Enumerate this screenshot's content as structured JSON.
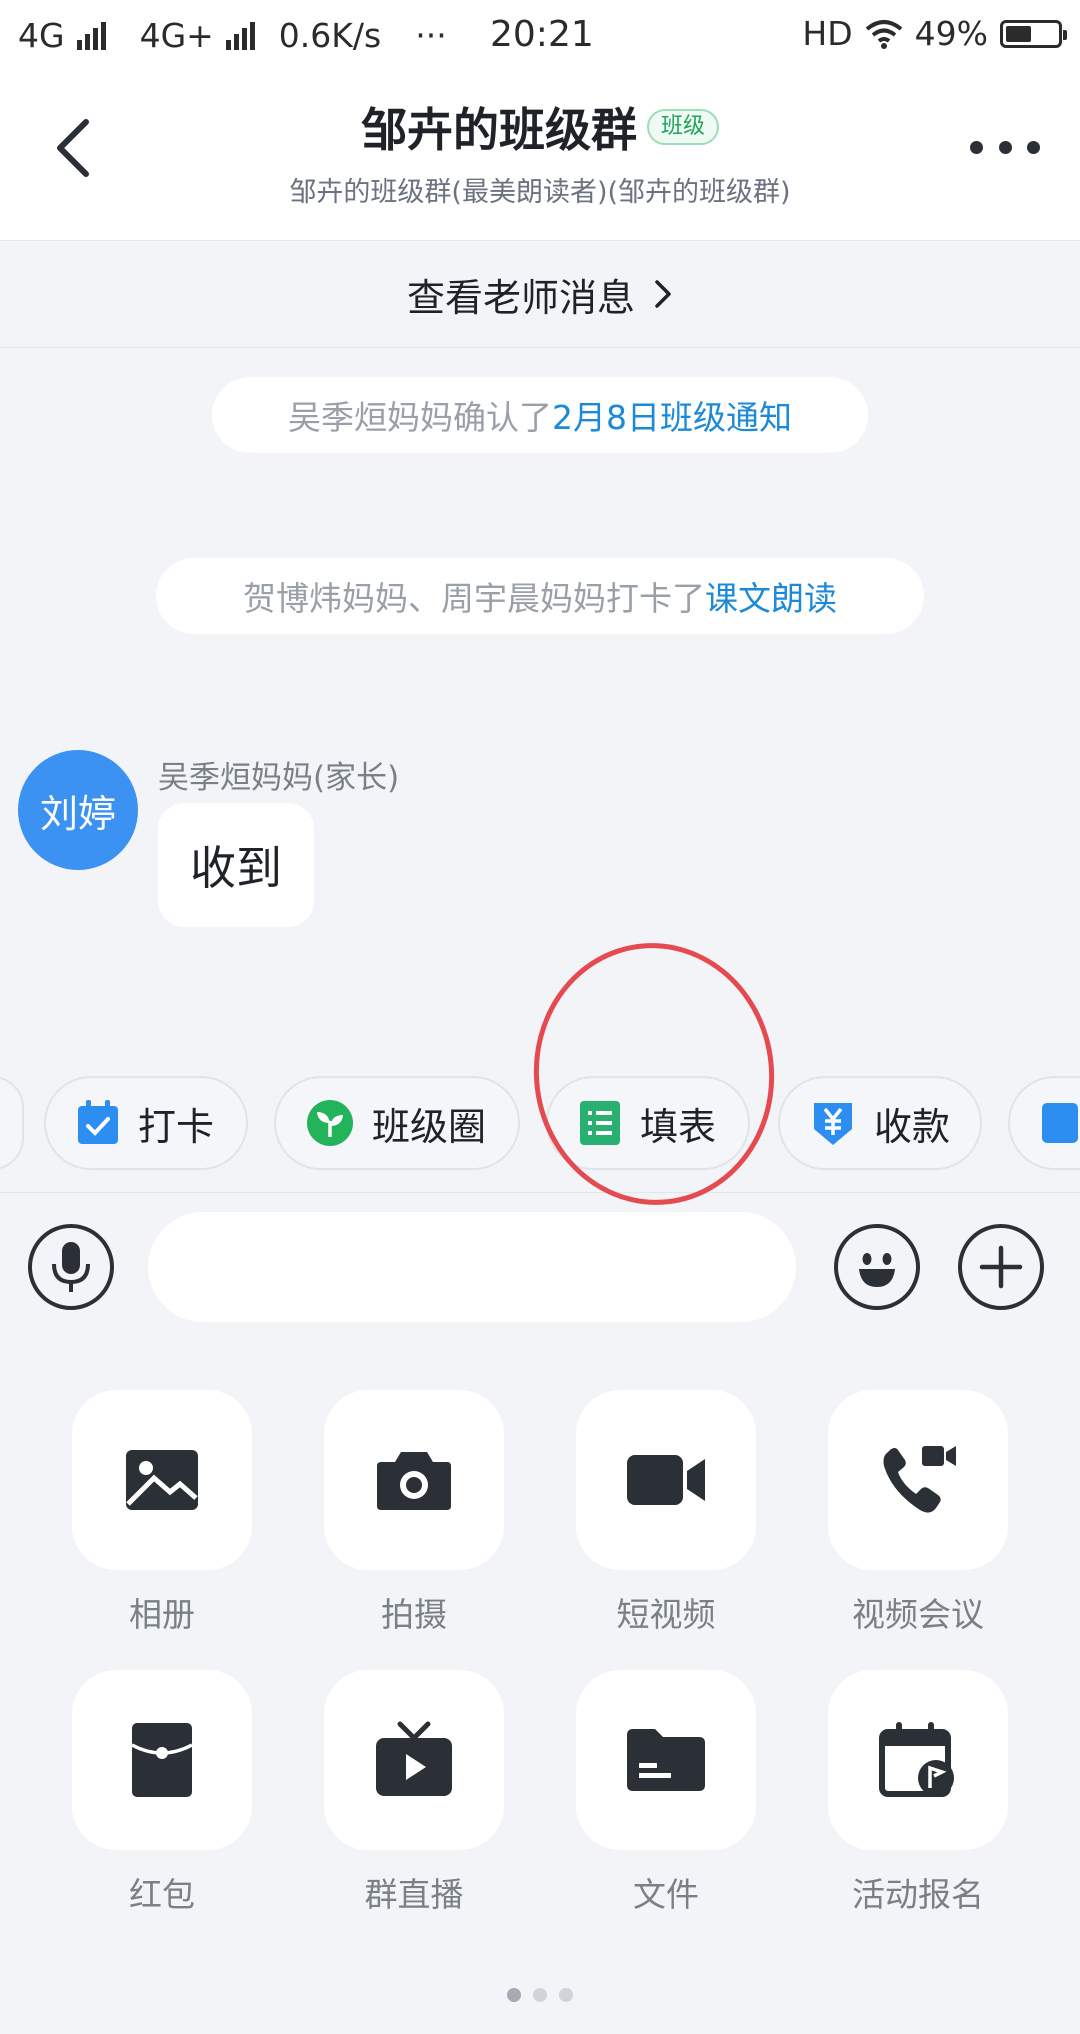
{
  "status_bar": {
    "network1": "4G",
    "network2": "4G+",
    "speed": "0.6K/s",
    "dots": "···",
    "time": "20:21",
    "hd": "HD",
    "battery_percent": "49%",
    "battery_level": 0.49
  },
  "header": {
    "title": "邹卉的班级群",
    "badge": "班级",
    "subtitle": "邹卉的班级群(最美朗读者)(邹卉的班级群)"
  },
  "teacher_bar": {
    "label": "查看老师消息",
    "chevron": "›"
  },
  "messages": {
    "system1": {
      "text": "吴季烜妈妈确认了",
      "link": "2月8日班级通知"
    },
    "system2": {
      "text": "贺博炜妈妈、周宇晨妈妈打卡了",
      "link": "课文朗读"
    },
    "chat": {
      "avatar_text": "刘婷",
      "sender": "吴季烜妈妈(家长)",
      "content": "收到"
    }
  },
  "quick_bar": {
    "items": [
      {
        "label": "打卡",
        "icon": "checkin-calendar-icon",
        "color": "#2b8ef0"
      },
      {
        "label": "班级圈",
        "icon": "sprout-icon",
        "color": "#22b35b"
      },
      {
        "label": "填表",
        "icon": "form-icon",
        "color": "#27b070"
      },
      {
        "label": "收款",
        "icon": "payment-yen-icon",
        "color": "#2b8ef0"
      }
    ]
  },
  "input": {
    "placeholder": "",
    "value": ""
  },
  "grid": {
    "items": [
      {
        "label": "相册",
        "icon": "image-icon"
      },
      {
        "label": "拍摄",
        "icon": "camera-icon"
      },
      {
        "label": "短视频",
        "icon": "video-icon"
      },
      {
        "label": "视频会议",
        "icon": "video-call-icon"
      },
      {
        "label": "红包",
        "icon": "red-packet-icon"
      },
      {
        "label": "群直播",
        "icon": "live-tv-icon"
      },
      {
        "label": "文件",
        "icon": "folder-icon"
      },
      {
        "label": "活动报名",
        "icon": "event-calendar-icon"
      }
    ]
  },
  "colors": {
    "link": "#1d8ad8",
    "accent_blue": "#3b92f2",
    "annotation": "#e44a4f",
    "icon_dark": "#2b2f36"
  }
}
